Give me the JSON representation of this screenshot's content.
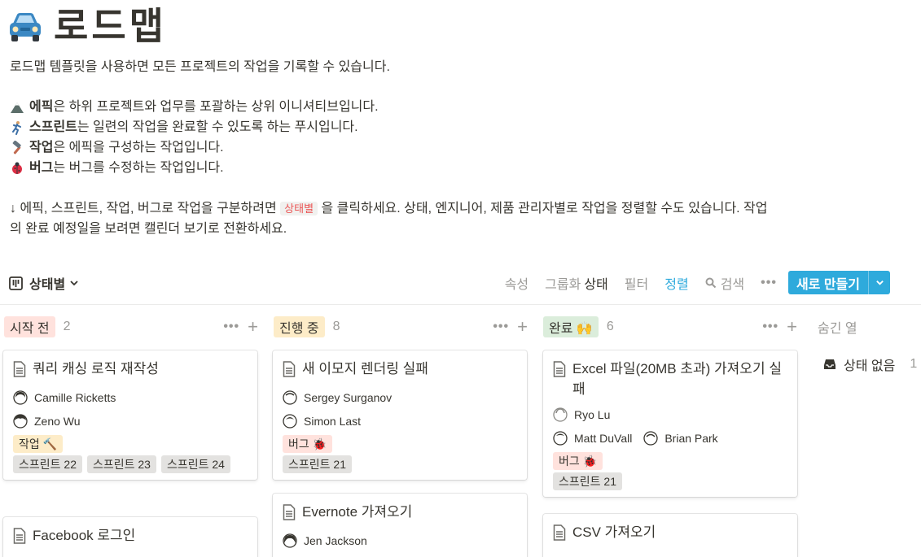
{
  "page": {
    "icon": "car-icon",
    "title": "로드맵",
    "intro": "로드맵 템플릿을 사용하면 모든 프로젝트의 작업을 기록할 수 있습니다.",
    "types": [
      {
        "icon": "mountain-icon",
        "name": "에픽",
        "desc": "은 하위 프로젝트와 업무를 포괄하는 상위 이니셔티브입니다."
      },
      {
        "icon": "runner-icon",
        "name": "스프린트",
        "desc": "는 일련의 작업을 완료할 수 있도록 하는 푸시입니다."
      },
      {
        "icon": "hammer-icon",
        "name": "작업",
        "desc": "은 에픽을 구성하는 작업입니다."
      },
      {
        "icon": "bug-icon",
        "name": "버그",
        "desc": "는 버그를 수정하는 작업입니다."
      }
    ],
    "guide_prefix": "↓ 에픽, 스프린트, 작업, 버그로 작업을 구분하려면",
    "guide_code": "상태별",
    "guide_suffix": "을 클릭하세요. 상태, 엔지니어, 제품 관리자별로 작업을 정렬할 수도 있습니다. 작업의 완료 예정일을 보려면 캘린더 보기로 전환하세요."
  },
  "toolbar": {
    "view_name": "상태별",
    "properties": "속성",
    "group_label": "그룹화",
    "group_value": "상태",
    "filter": "필터",
    "sort": "정렬",
    "search": "검색",
    "more": "•••",
    "new_button": "새로 만들기"
  },
  "columns": [
    {
      "label": "시작 전",
      "count": "2",
      "color": "#ffe2dd",
      "cards": [
        {
          "title": "쿼리 캐싱 로직 재작성",
          "people": [
            [
              "Camille Ricketts"
            ],
            [
              "Zeno Wu"
            ]
          ],
          "tags": [
            {
              "label": "작업 🔨",
              "color": "#fdecc8"
            }
          ],
          "sprints": [
            "스프린트 22",
            "스프린트 23",
            "스프린트 24"
          ]
        },
        {
          "title": "Facebook 로그인",
          "people": [],
          "tags": [],
          "sprints": []
        }
      ]
    },
    {
      "label": "진행 중",
      "count": "8",
      "color": "#fdecc8",
      "cards": [
        {
          "title": "새 이모지 렌더링 실패",
          "people": [
            [
              "Sergey Surganov"
            ],
            [
              "Simon Last"
            ]
          ],
          "tags": [
            {
              "label": "버그 🐞",
              "color": "#ffe2dd"
            }
          ],
          "sprints": [
            "스프린트 21"
          ]
        },
        {
          "title": "Evernote 가져오기",
          "people": [
            [
              "Jen Jackson"
            ]
          ],
          "tags": [],
          "sprints": []
        }
      ]
    },
    {
      "label": "완료 🙌",
      "count": "6",
      "color": "#dbeddb",
      "cards": [
        {
          "title": "Excel 파일(20MB 초과) 가져오기 실패",
          "people": [
            [
              "Ryo Lu"
            ],
            [
              "Matt DuVall",
              "Brian Park"
            ]
          ],
          "tags": [
            {
              "label": "버그 🐞",
              "color": "#ffe2dd"
            }
          ],
          "sprints": [
            "스프린트 21"
          ]
        },
        {
          "title": "CSV 가져오기",
          "people": [],
          "tags": [],
          "sprints": []
        }
      ]
    }
  ],
  "hidden": {
    "label": "숨긴 열",
    "item_label": "상태 없음",
    "item_count": "1"
  },
  "colors": {
    "accent": "#2eaadc",
    "sprint_tag": "#e3e2e0"
  }
}
